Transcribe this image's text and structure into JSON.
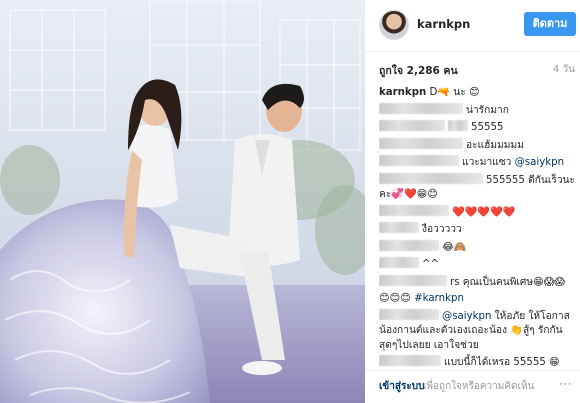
{
  "post": {
    "username": "karnkpn",
    "follow_label": "ติดตาม",
    "likes_label": "ถูกใจ 2,286 คน",
    "age_label": "4 วัน"
  },
  "comments": [
    {
      "user": "karnkpn",
      "text": "D🔫 นะ 😊"
    },
    {
      "user": "",
      "text": "น่ารักมาก"
    },
    {
      "user": "",
      "text": "55555"
    },
    {
      "user": "",
      "text": "อะแฮ้มมมมม"
    },
    {
      "user": "",
      "text": "แวะมาแซว",
      "mention": "@saiykpn"
    },
    {
      "user": "",
      "text": "555555 ดีกันเร็วนะ คะ💞❤️😁😊"
    },
    {
      "user": "",
      "text": "❤️❤️❤️❤️❤️"
    },
    {
      "user": "",
      "text": "งือววววว"
    },
    {
      "user": "",
      "text": "😂🙈"
    },
    {
      "user": "",
      "text": "^^"
    },
    {
      "user": "",
      "text": "rs คุณเป็นคนพิเศษ😁😱😱"
    },
    {
      "user": "",
      "text": "😊😊😊",
      "mention": "#karnkpn"
    },
    {
      "user": "",
      "text": "ให้อภัย ให้โอกาส น้องกานต์และตัวเองเถอะน้อง 👏สู้ๆ รักกันสุดๆไปเลยย เอาใจช่วย",
      "mention": "@saiykpn"
    },
    {
      "user": "",
      "text": "แบบนี้ก็ได้เหรอ 55555 😁"
    }
  ],
  "footer": {
    "login_label": "เข้าสู่ระบบ",
    "hint": "เพื่อถูกใจหรือความคิดเห็น",
    "more_icon": "⋯"
  }
}
